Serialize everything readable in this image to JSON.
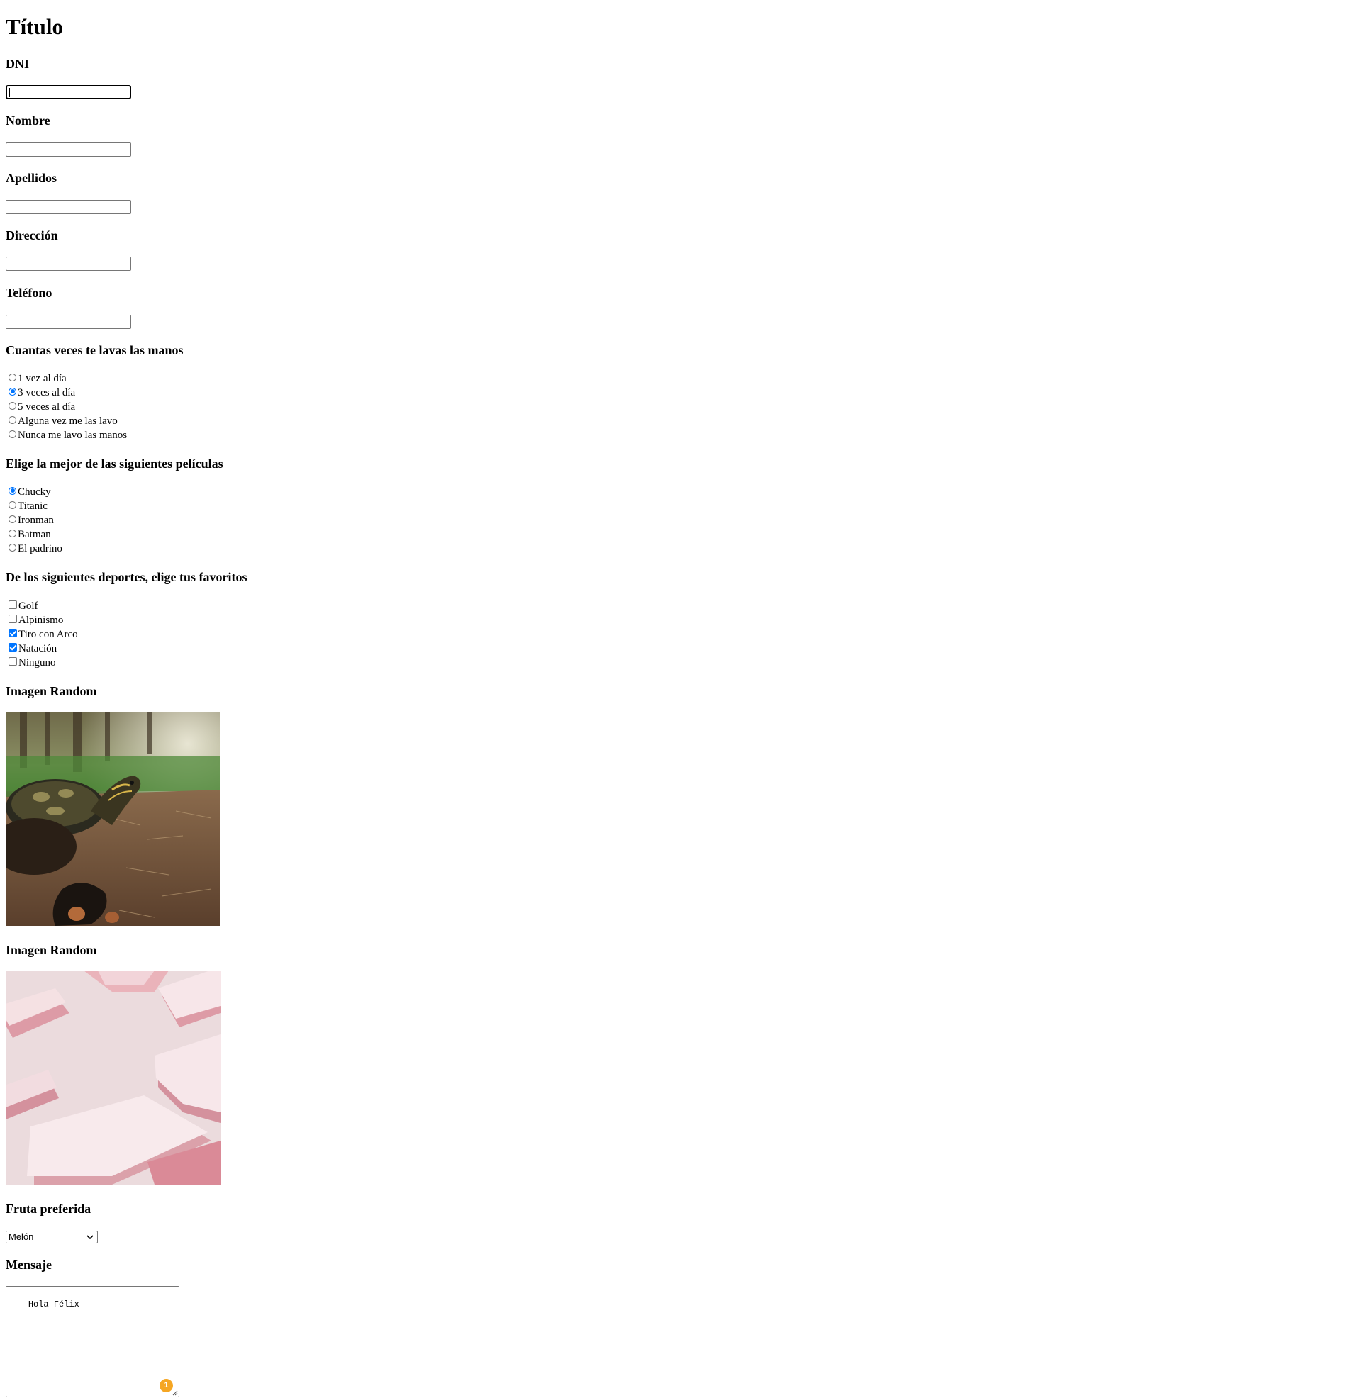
{
  "page": {
    "title": "Título"
  },
  "fields": {
    "dni": {
      "label": "DNI",
      "value": ""
    },
    "nombre": {
      "label": "Nombre",
      "value": ""
    },
    "apellidos": {
      "label": "Apellidos",
      "value": ""
    },
    "direccion": {
      "label": "Dirección",
      "value": ""
    },
    "telefono": {
      "label": "Teléfono",
      "value": ""
    }
  },
  "handwash": {
    "question": "Cuantas veces te lavas las manos",
    "options": [
      {
        "label": "1 vez al día",
        "checked": false
      },
      {
        "label": "3 veces al día",
        "checked": true
      },
      {
        "label": "5 veces al día",
        "checked": false
      },
      {
        "label": "Alguna vez me las lavo",
        "checked": false
      },
      {
        "label": "Nunca me lavo las manos",
        "checked": false
      }
    ]
  },
  "movies": {
    "question": "Elige la mejor de las siguientes películas",
    "options": [
      {
        "label": "Chucky",
        "checked": true
      },
      {
        "label": "Titanic",
        "checked": false
      },
      {
        "label": "Ironman",
        "checked": false
      },
      {
        "label": "Batman",
        "checked": false
      },
      {
        "label": "El padrino",
        "checked": false
      }
    ]
  },
  "sports": {
    "question": "De los siguientes deportes, elige tus favoritos",
    "options": [
      {
        "label": "Golf",
        "checked": false
      },
      {
        "label": "Alpinismo",
        "checked": false
      },
      {
        "label": "Tiro con Arco",
        "checked": true
      },
      {
        "label": "Natación",
        "checked": true
      },
      {
        "label": "Ninguno",
        "checked": false
      }
    ]
  },
  "images": [
    {
      "label": "Imagen Random",
      "subject": "turtle-photo"
    },
    {
      "label": "Imagen Random",
      "subject": "pink-abstract-photo"
    }
  ],
  "fruit": {
    "label": "Fruta preferida",
    "selected": "Melón"
  },
  "message": {
    "label": "Mensaje",
    "value": "Hola Félix",
    "badge_count": "1"
  },
  "colors": {
    "accent": "#0075ff",
    "badge": "#f5a623",
    "border": "#767676"
  }
}
